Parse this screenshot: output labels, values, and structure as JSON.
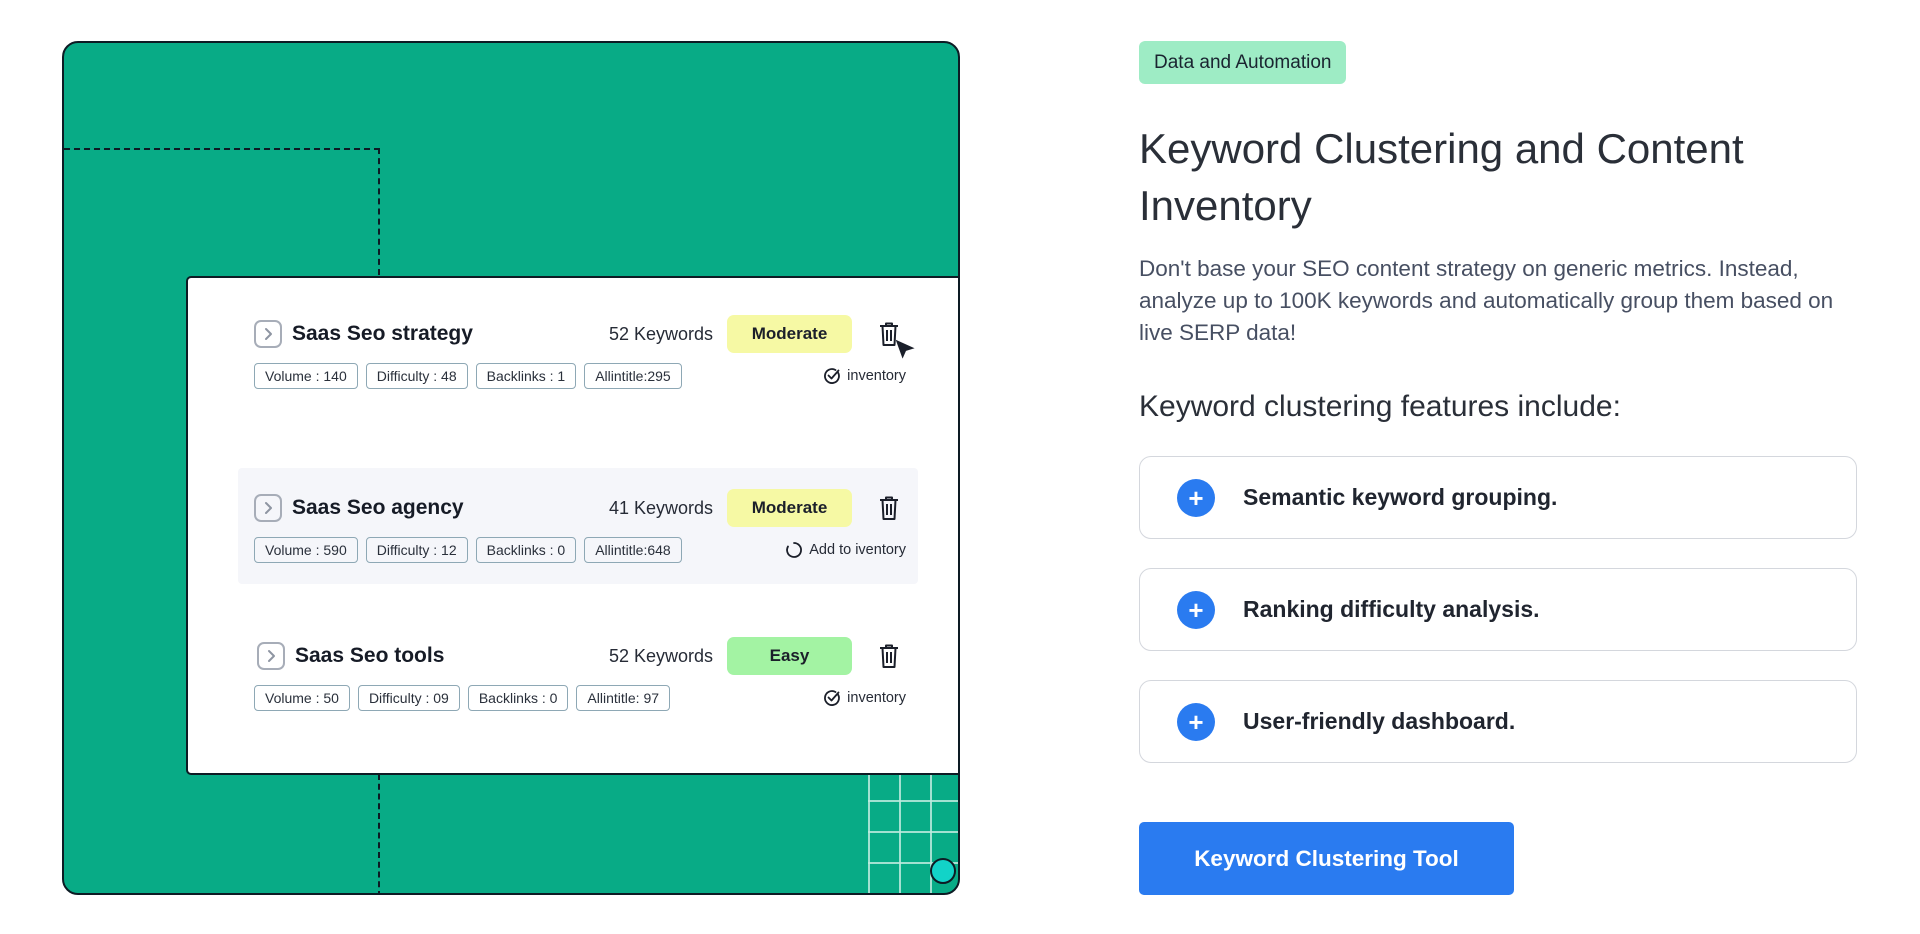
{
  "colors": {
    "illustration_bg": "#08ab86",
    "tag_bg": "#9eecc5",
    "badge_moderate": "#f6f9a4",
    "badge_easy": "#a3f3a3",
    "accent_blue": "#2a7bf0"
  },
  "clusters": [
    {
      "title": "Saas Seo strategy",
      "keywords": "52 Keywords",
      "badge": "Moderate",
      "chips": [
        "Volume : 140",
        "Difficulty : 48",
        "Backlinks : 1",
        "Allintitle:295"
      ],
      "inventory_label": "inventory",
      "inventory_icon": "check-circle-icon"
    },
    {
      "title": "Saas Seo agency",
      "keywords": "41 Keywords",
      "badge": "Moderate",
      "chips": [
        "Volume : 590",
        "Difficulty : 12",
        "Backlinks : 0",
        "Allintitle:648"
      ],
      "inventory_label": "Add to iventory",
      "inventory_icon": "loading-spinner-icon"
    },
    {
      "title": "Saas Seo tools",
      "keywords": "52 Keywords",
      "badge": "Easy",
      "chips": [
        "Volume : 50",
        "Difficulty : 09",
        "Backlinks : 0",
        "Allintitle: 97"
      ],
      "inventory_label": "inventory",
      "inventory_icon": "check-circle-icon"
    }
  ],
  "content": {
    "tag": "Data and Automation",
    "headline": "Keyword Clustering and Content Inventory",
    "description": "Don't base your SEO content strategy on generic metrics. Instead, analyze up to 100K keywords and automatically group them based on live SERP data!",
    "features_title": "Keyword clustering features include:",
    "features": [
      "Semantic keyword grouping.",
      "Ranking difficulty analysis.",
      "User-friendly dashboard."
    ],
    "feature_icon": "plus-icon",
    "cta_label": "Keyword Clustering Tool"
  }
}
